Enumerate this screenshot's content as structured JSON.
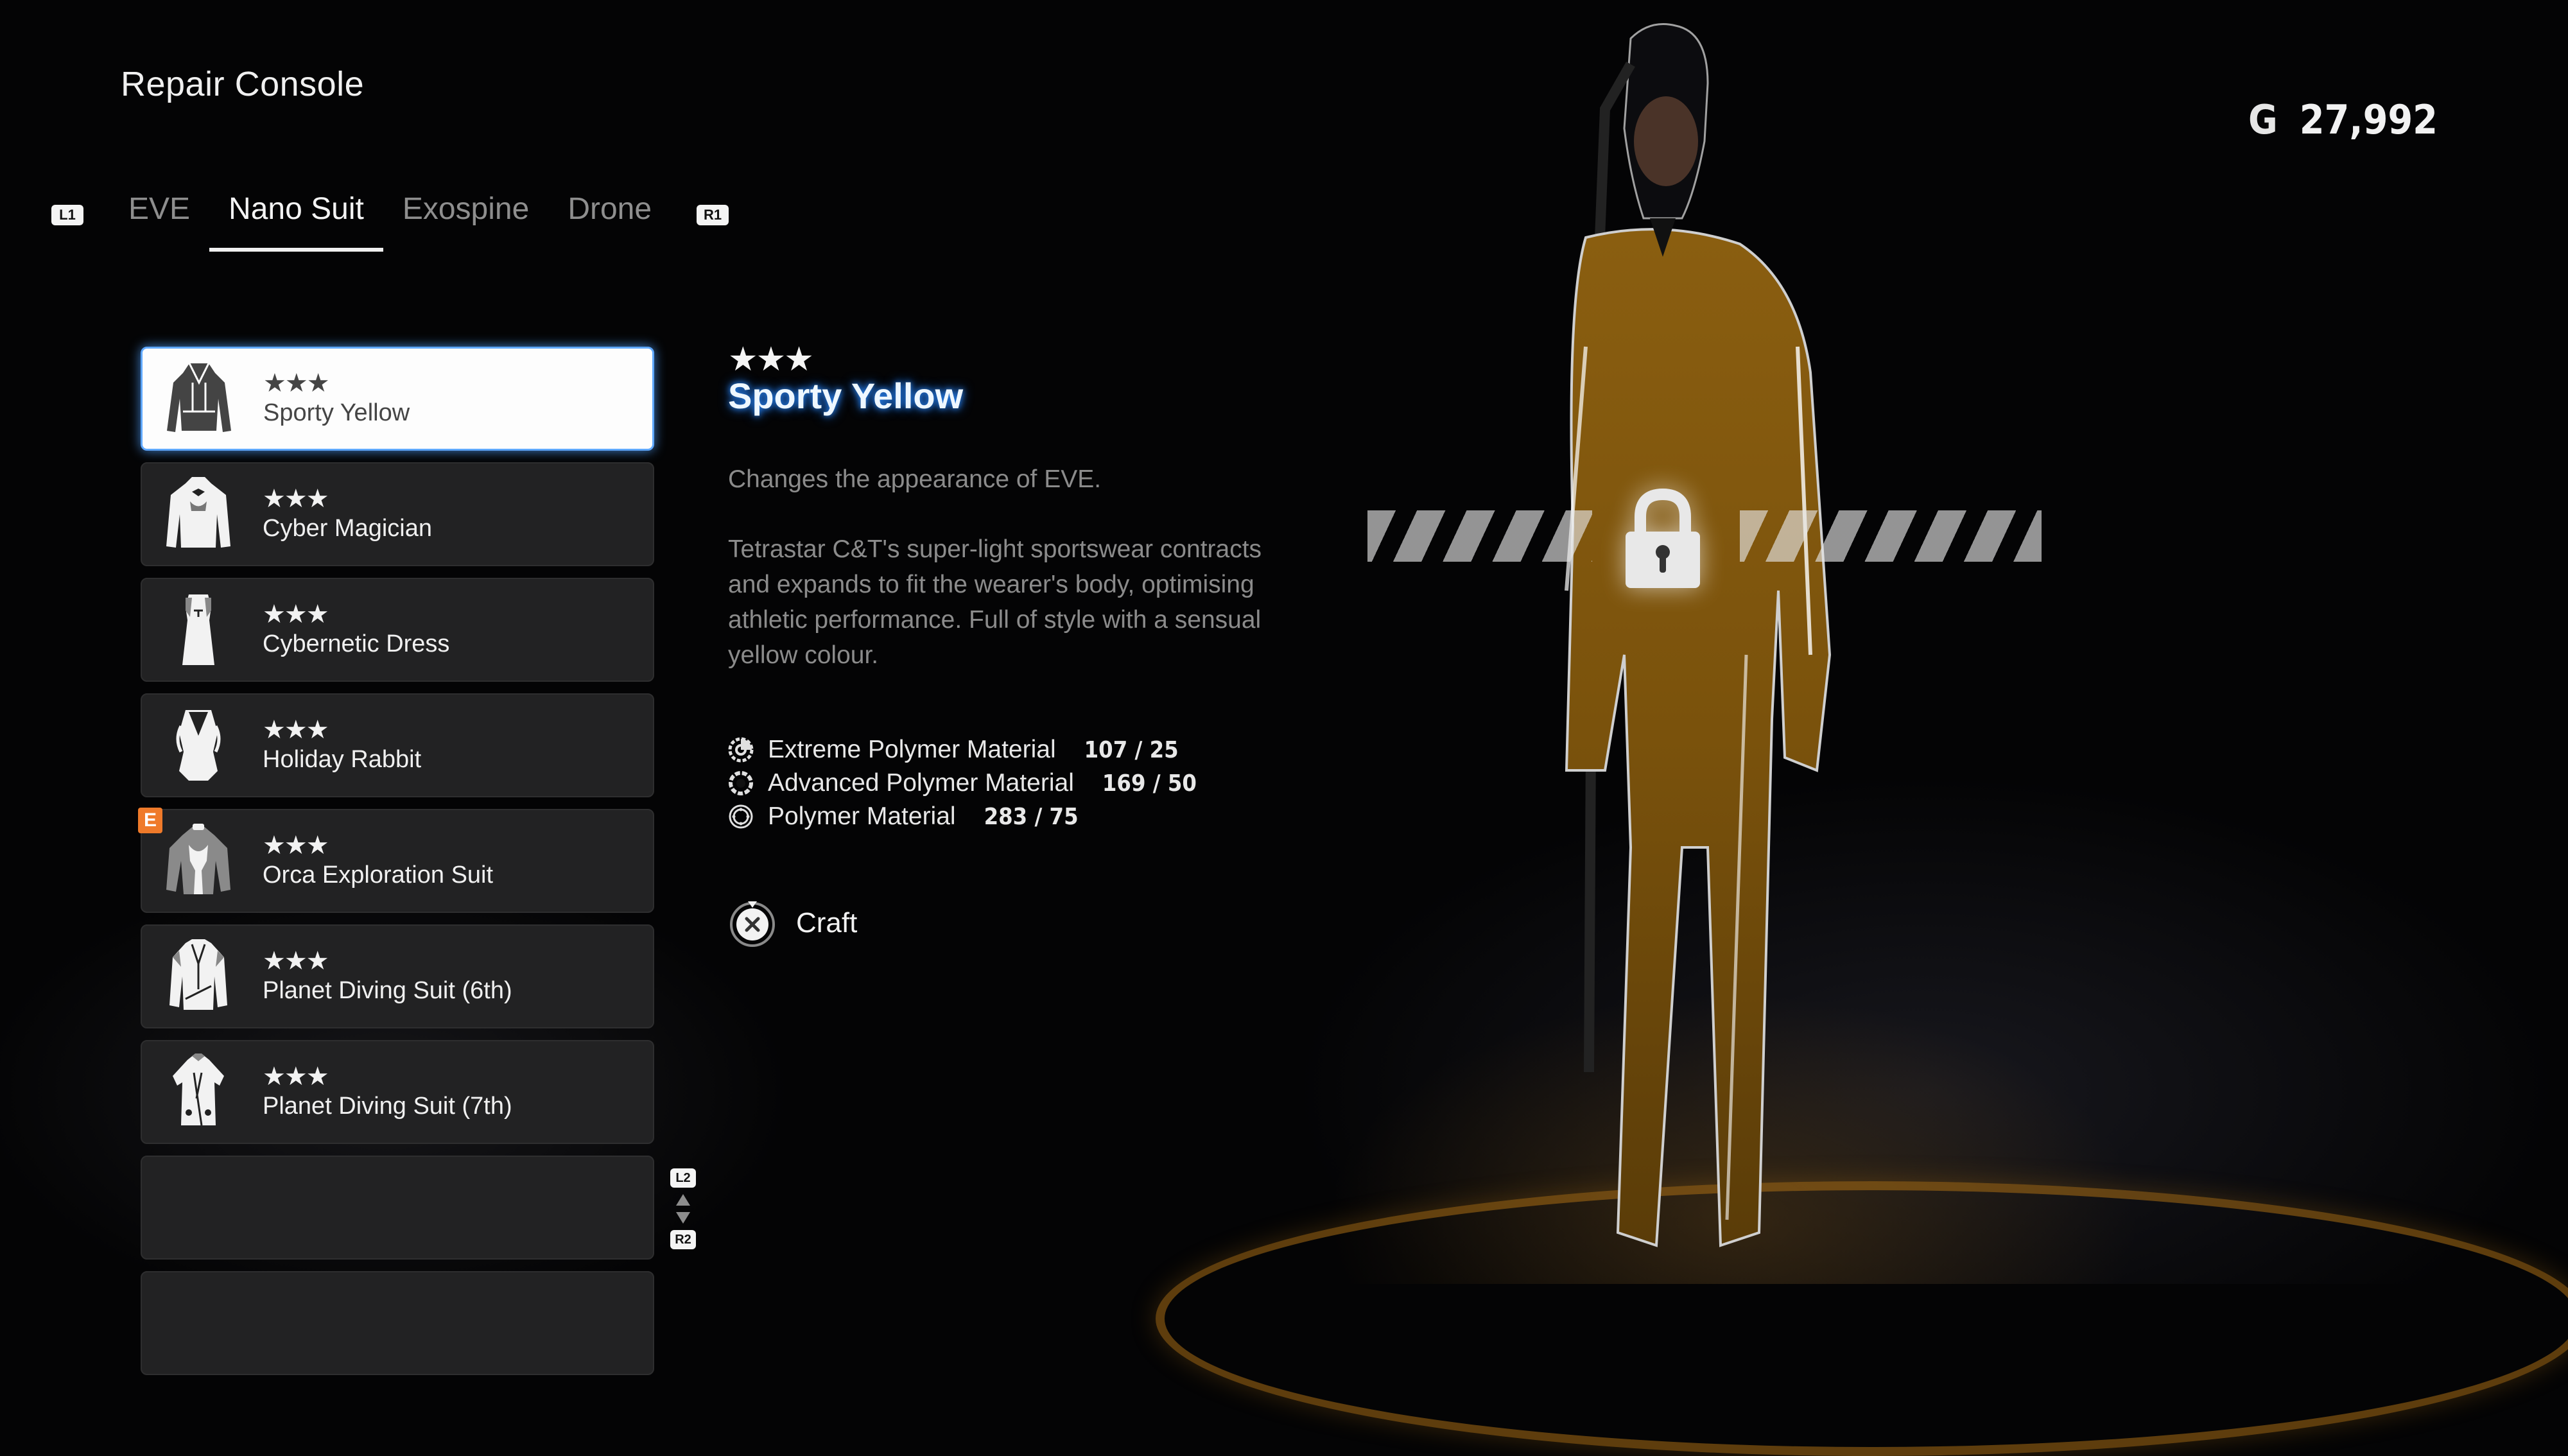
{
  "window": {
    "title": "Repair Console"
  },
  "currency": {
    "symbol": "G",
    "amount": "27,992"
  },
  "tabs": {
    "left_hint": "L1",
    "right_hint": "R1",
    "items": [
      {
        "label": "EVE",
        "active": false
      },
      {
        "label": "Nano Suit",
        "active": true
      },
      {
        "label": "Exospine",
        "active": false
      },
      {
        "label": "Drone",
        "active": false
      }
    ]
  },
  "suit_list": {
    "items": [
      {
        "stars": "★★★",
        "rating": 3,
        "name": "Sporty Yellow",
        "icon": "hoodie-icon",
        "selected": true,
        "badge": ""
      },
      {
        "stars": "★★★",
        "rating": 3,
        "name": "Cyber Magician",
        "icon": "tuxedo-jacket-icon",
        "selected": false,
        "badge": ""
      },
      {
        "stars": "★★★",
        "rating": 3,
        "name": "Cybernetic Dress",
        "icon": "dress-icon",
        "selected": false,
        "badge": ""
      },
      {
        "stars": "★★★",
        "rating": 3,
        "name": "Holiday Rabbit",
        "icon": "bodysuit-icon",
        "selected": false,
        "badge": ""
      },
      {
        "stars": "★★★",
        "rating": 3,
        "name": "Orca Exploration Suit",
        "icon": "exploration-suit-icon",
        "selected": false,
        "badge": "E"
      },
      {
        "stars": "★★★",
        "rating": 3,
        "name": "Planet Diving Suit (6th)",
        "icon": "diving-suit-icon",
        "selected": false,
        "badge": ""
      },
      {
        "stars": "★★★",
        "rating": 3,
        "name": "Planet Diving Suit (7th)",
        "icon": "diving-suit-icon",
        "selected": false,
        "badge": ""
      }
    ],
    "scroll_up_hint": "L2",
    "scroll_down_hint": "R2"
  },
  "detail": {
    "stars": "★★★",
    "name": "Sporty Yellow",
    "description": [
      "Changes the appearance of EVE.",
      "Tetrastar C&T's super-light sportswear contracts and expands to fit the wearer's body, optimising athletic performance. Full of style with a sensual yellow colour."
    ],
    "materials": [
      {
        "name": "Extreme Polymer Material",
        "count": "107 / 25",
        "icon": "extreme-polymer-icon"
      },
      {
        "name": "Advanced Polymer Material",
        "count": "169 / 50",
        "icon": "advanced-polymer-icon"
      },
      {
        "name": "Polymer Material",
        "count": "283 / 75",
        "icon": "polymer-icon"
      }
    ],
    "action": {
      "label": "Craft",
      "button": "cross-button-icon"
    }
  },
  "preview": {
    "locked": true,
    "accent_color": "#b8860b"
  },
  "colors": {
    "selection_glow": "#5fa8ff",
    "badge": "#ef7a2a",
    "title_glow": "#2a8cff"
  }
}
